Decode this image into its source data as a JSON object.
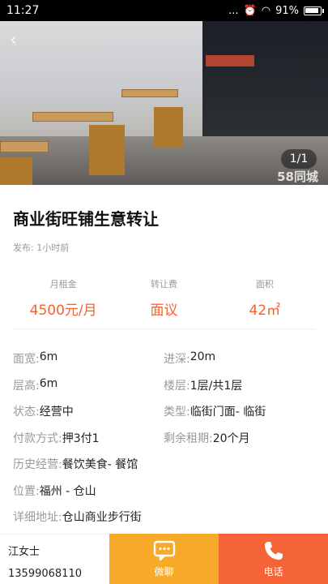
{
  "status": {
    "time": "11:27",
    "signal": "...",
    "battery": "91%"
  },
  "hero": {
    "photo_counter": "1/1",
    "watermark": "58同城",
    "back_icon": "back-icon"
  },
  "listing": {
    "title": "商业街旺铺生意转让",
    "published": "发布: 1小时前"
  },
  "key_stats": [
    {
      "label": "月租金",
      "value": "4500元/月"
    },
    {
      "label": "转让费",
      "value": "面议"
    },
    {
      "label": "面积",
      "value": "42㎡"
    }
  ],
  "details": {
    "width_label": "面宽:",
    "width_value": "6m",
    "depth_label": "进深:",
    "depth_value": "20m",
    "height_label": "层高:",
    "height_value": "6m",
    "floor_label": "楼层:",
    "floor_value": "1层/共1层",
    "state_label": "状态:",
    "state_value": "经营中",
    "type_label": "类型:",
    "type_value": "临街门面- 临街",
    "payment_label": "付款方式:",
    "payment_value": "押3付1",
    "lease_label": "剩余租期:",
    "lease_value": "20个月",
    "history_label": "历史经营:",
    "history_value": "餐饮美食- 餐馆",
    "location_label": "位置:",
    "location_value": "福州 - 仓山",
    "address_label": "详细地址:",
    "address_value": "仓山商业步行街"
  },
  "bottom": {
    "contact_name": "江女士",
    "contact_phone": "13599068110",
    "chat_label": "微聊",
    "call_label": "电话"
  },
  "colors": {
    "accent": "#f5612c",
    "chat": "#f7a92a",
    "call": "#f46436"
  }
}
